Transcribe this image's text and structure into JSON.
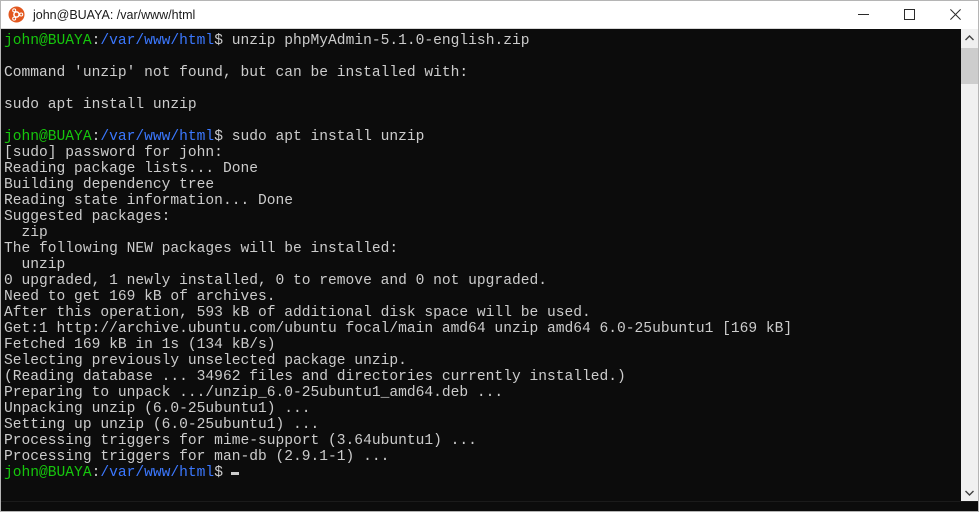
{
  "window": {
    "title": "john@BUAYA: /var/www/html",
    "app_icon": "ubuntu-icon",
    "colors": {
      "terminal_bg": "#0c0c0c",
      "terminal_fg": "#cccccc",
      "prompt_user": "#16c60c",
      "prompt_path": "#3b78ff",
      "titlebar_bg": "#ffffff",
      "ubuntu_orange": "#e2571e"
    },
    "controls": {
      "minimize": "minimize-button",
      "maximize": "maximize-button",
      "close": "close-button"
    }
  },
  "prompt": {
    "user_host": "john@BUAYA",
    "colon": ":",
    "path": "/var/www/html",
    "sigil": "$"
  },
  "terminal": {
    "lines": [
      {
        "type": "prompt",
        "command": " unzip phpMyAdmin-5.1.0-english.zip"
      },
      {
        "type": "blank",
        "text": ""
      },
      {
        "type": "out",
        "text": "Command 'unzip' not found, but can be installed with:"
      },
      {
        "type": "blank",
        "text": ""
      },
      {
        "type": "out",
        "text": "sudo apt install unzip"
      },
      {
        "type": "blank",
        "text": ""
      },
      {
        "type": "prompt",
        "command": " sudo apt install unzip"
      },
      {
        "type": "out",
        "text": "[sudo] password for john:"
      },
      {
        "type": "out",
        "text": "Reading package lists... Done"
      },
      {
        "type": "out",
        "text": "Building dependency tree"
      },
      {
        "type": "out",
        "text": "Reading state information... Done"
      },
      {
        "type": "out",
        "text": "Suggested packages:"
      },
      {
        "type": "out",
        "text": "  zip"
      },
      {
        "type": "out",
        "text": "The following NEW packages will be installed:"
      },
      {
        "type": "out",
        "text": "  unzip"
      },
      {
        "type": "out",
        "text": "0 upgraded, 1 newly installed, 0 to remove and 0 not upgraded."
      },
      {
        "type": "out",
        "text": "Need to get 169 kB of archives."
      },
      {
        "type": "out",
        "text": "After this operation, 593 kB of additional disk space will be used."
      },
      {
        "type": "out",
        "text": "Get:1 http://archive.ubuntu.com/ubuntu focal/main amd64 unzip amd64 6.0-25ubuntu1 [169 kB]"
      },
      {
        "type": "out",
        "text": "Fetched 169 kB in 1s (134 kB/s)"
      },
      {
        "type": "out",
        "text": "Selecting previously unselected package unzip."
      },
      {
        "type": "out",
        "text": "(Reading database ... 34962 files and directories currently installed.)"
      },
      {
        "type": "out",
        "text": "Preparing to unpack .../unzip_6.0-25ubuntu1_amd64.deb ..."
      },
      {
        "type": "out",
        "text": "Unpacking unzip (6.0-25ubuntu1) ..."
      },
      {
        "type": "out",
        "text": "Setting up unzip (6.0-25ubuntu1) ..."
      },
      {
        "type": "out",
        "text": "Processing triggers for mime-support (3.64ubuntu1) ..."
      },
      {
        "type": "out",
        "text": "Processing triggers for man-db (2.9.1-1) ..."
      },
      {
        "type": "prompt",
        "command": "",
        "cursor": true
      }
    ]
  },
  "scrollbar": {
    "up_arrow": "scroll-up-arrow",
    "down_arrow": "scroll-down-arrow",
    "thumb": "scroll-thumb"
  }
}
